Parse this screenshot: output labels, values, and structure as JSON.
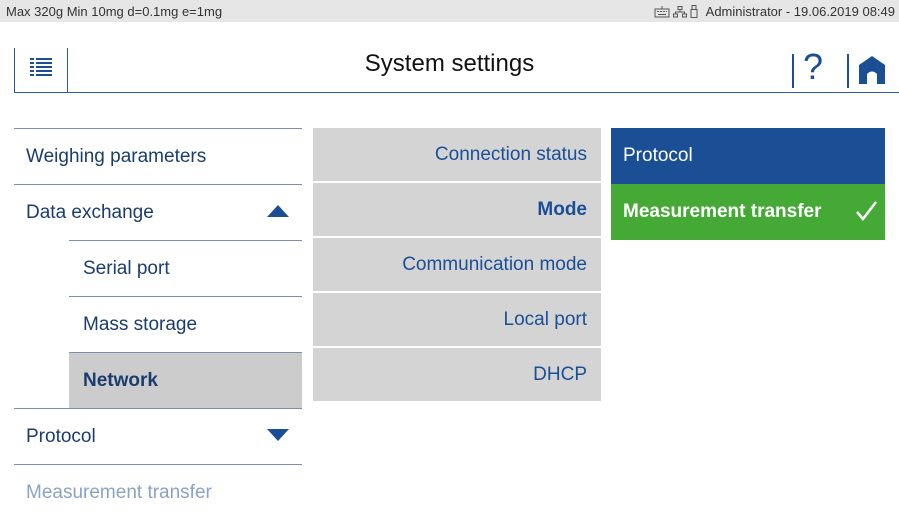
{
  "status_bar": {
    "scale_info": "Max 320g  Min 10mg  d=0.1mg  e=1mg",
    "user_datetime": "Administrator  -  19.06.2019 08:49",
    "icons": [
      "keyboard-icon",
      "network-icon",
      "usb-icon"
    ]
  },
  "header": {
    "title": "System settings",
    "help_label": "?",
    "menu_icon": "list-menu-icon",
    "home_icon": "home-icon"
  },
  "nav": {
    "items": [
      {
        "label": "Weighing parameters"
      },
      {
        "label": "Data exchange",
        "state": "expanded"
      },
      {
        "label": "Serial port"
      },
      {
        "label": "Mass storage"
      },
      {
        "label": "Network",
        "selected": true
      },
      {
        "label": "Protocol",
        "state": "collapsed"
      },
      {
        "label": "Measurement transfer"
      }
    ]
  },
  "options": {
    "items": [
      {
        "label": "Connection status"
      },
      {
        "label": "Mode",
        "selected": true
      },
      {
        "label": "Communication mode"
      },
      {
        "label": "Local port"
      },
      {
        "label": "DHCP"
      }
    ]
  },
  "values": {
    "header": "Protocol",
    "selected": "Measurement transfer"
  },
  "colors": {
    "accent_blue": "#1a4f96",
    "selected_green": "#45aa35",
    "option_gray": "#d4d4d4",
    "active_gray": "#cccccc"
  }
}
